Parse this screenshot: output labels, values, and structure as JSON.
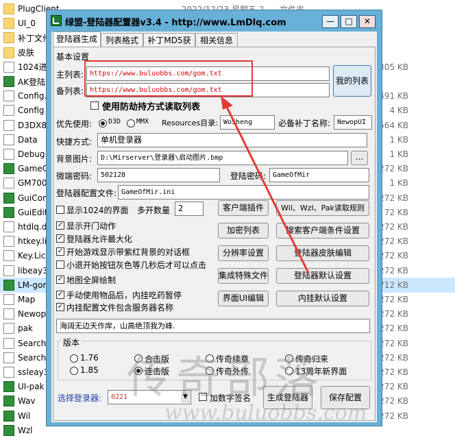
{
  "explorer": {
    "rows": [
      {
        "name": "PlugClient",
        "date": "2022/12/23 星期五 2...",
        "type": "文件夹",
        "size": "",
        "icon": "folder-icon"
      },
      {
        "name": "UI_0",
        "size": "",
        "icon": "folder-icon"
      },
      {
        "name": "补丁文件",
        "size": "",
        "icon": "folder-icon"
      },
      {
        "name": "皮肤",
        "size": "",
        "icon": "folder-icon"
      },
      {
        "name": "1024进",
        "size": "305 KB",
        "icon": "bmp-file-icon"
      },
      {
        "name": "AK登陆",
        "size": "",
        "icon": "ak-app-icon"
      },
      {
        "name": "Config.",
        "size": "491 KB",
        "icon": "config-file-icon"
      },
      {
        "name": "Config",
        "size": "4 KB",
        "icon": "config-file-icon"
      },
      {
        "name": "D3DX8",
        "size": "564 KB",
        "icon": "dll-file-icon"
      },
      {
        "name": "Data",
        "size": "1 KB",
        "icon": "file-icon"
      },
      {
        "name": "Debug",
        "size": "1 KB",
        "icon": "file-icon"
      },
      {
        "name": "GameC",
        "size": "272 KB",
        "icon": "app-icon"
      },
      {
        "name": "GM700",
        "size": "1 KB",
        "icon": "file-icon"
      },
      {
        "name": "GuiCon",
        "size": "272 KB",
        "icon": "app-icon"
      },
      {
        "name": "GuiEdit",
        "size": "72 KB",
        "icon": "app-icon"
      },
      {
        "name": "htdlq.d",
        "size": "272 KB",
        "icon": "dll-file-icon"
      },
      {
        "name": "htkey.li",
        "size": "272 KB",
        "icon": "file-icon"
      },
      {
        "name": "Key.Lic",
        "size": "272 KB",
        "icon": "file-icon"
      },
      {
        "name": "libeay3",
        "size": "272 KB",
        "icon": "dll-file-icon"
      },
      {
        "name": "LM-gor",
        "size": "712 KB",
        "icon": "lm-app-icon",
        "selected": true
      },
      {
        "name": "Map",
        "size": "272 KB",
        "icon": "file-icon"
      },
      {
        "name": "Newop",
        "size": "272 KB",
        "icon": "file-icon"
      },
      {
        "name": "pak",
        "size": "272 KB",
        "icon": "file-icon"
      },
      {
        "name": "SearchI",
        "size": "272 KB",
        "icon": "file-icon"
      },
      {
        "name": "SearchI",
        "size": "272 KB",
        "icon": "file-icon"
      },
      {
        "name": "ssleay3",
        "size": "272 KB",
        "icon": "dll-file-icon"
      },
      {
        "name": "UI-pak",
        "size": "272 KB",
        "icon": "app-icon"
      },
      {
        "name": "Wav",
        "size": "272 KB",
        "icon": "app-icon"
      },
      {
        "name": "Wil",
        "size": "272 KB",
        "icon": "app-icon"
      },
      {
        "name": "Wzl",
        "size": "",
        "icon": "app-icon"
      }
    ]
  },
  "window": {
    "title": "绿盟-登陆器配置器v3.4 - http://www.LmDlq.com",
    "controls": {
      "min": "—",
      "max": "□",
      "close": "✕"
    },
    "tabs": [
      "登陆器生成",
      "列表格式",
      "补丁MD5获取",
      "相关信息"
    ],
    "section_basic": "基本设置",
    "main_list_label": "主列表:",
    "main_list_value": "https://www.buluobbs.com/gom.txt",
    "backup_list_label": "备列表:",
    "backup_list_value": "https://www.buluobbs.com/gom.txt",
    "my_list_button": "我的列表",
    "anti_hijack_label": "使用防劫持方式读取列表",
    "priority_label": "优先使用:",
    "priority_d3d": "D3D",
    "priority_mmx": "MMX",
    "resources_label": "Resources目录:",
    "resources_value": "WoSheng",
    "patch_name_label": "必备补丁名称:",
    "patch_name_value": "NewopUI",
    "shortcut_label": "快捷方式:",
    "shortcut_value": "单机登录器",
    "bg_image_label": "背景图片:",
    "bg_image_value": "D:\\Mirserver\\登录器\\启动图片.bmp",
    "browse_button": "...",
    "wd_password_label": "微端密码:",
    "wd_password_value": "502128",
    "login_password_label": "登陆密码:",
    "login_password_value": "GameOfMir",
    "config_file_label": "登陆器配置文件:",
    "config_file_value": "GameOfMir.ini",
    "checkboxes": [
      {
        "label": "显示1024的界面",
        "checked": false
      },
      {
        "label": "显示开门动作",
        "checked": true
      },
      {
        "label": "登陆器允许最大化",
        "checked": true
      },
      {
        "label": "开始游戏显示带紫红背景的对话框",
        "checked": true
      },
      {
        "label": "小退开始按钮灰色等几秒后才可以点击",
        "checked": false
      },
      {
        "label": "地图全屏绘制",
        "checked": true
      },
      {
        "label": "手动使用物品后，内挂吃药暂停",
        "checked": true
      },
      {
        "label": "内挂配置文件包含服务器名称",
        "checked": true
      }
    ],
    "multi_open_label": "多开数量",
    "multi_open_value": "2",
    "buttons_mid": [
      "客户端插件",
      "加密列表",
      "分辨率设置",
      "集成特殊文件",
      "界面UI编辑"
    ],
    "buttons_right": [
      "Wil、Wzl、Pak读取规则",
      "搜索客户端条件设置",
      "登陆器皮肤编辑",
      "登陆器默认设置",
      "内挂默认设置"
    ],
    "motto_value": "海阔无边天作岸，山高绝顶我为峰.",
    "version_label": "版本",
    "versions": [
      {
        "label": "1.76",
        "selected": false
      },
      {
        "label": "合击版",
        "selected": false
      },
      {
        "label": "传奇续章",
        "selected": false
      },
      {
        "label": "传奇归来",
        "selected": false
      },
      {
        "label": "1.85",
        "selected": false
      },
      {
        "label": "连击版",
        "selected": true
      },
      {
        "label": "传奇外传",
        "selected": false
      },
      {
        "label": "13周年新界面",
        "selected": false
      }
    ],
    "select_login_label": "选择登录器:",
    "select_login_value": "0221",
    "digital_sign_label": "加数字签名",
    "generate_button": "生成登陆器",
    "save_button": "保存配置"
  },
  "watermark": {
    "brand": "传奇部落",
    "url": "www.buluobbs.com"
  },
  "colors": {
    "title_bar": "#67b0d8",
    "annotation": "#e53935",
    "url_text": "#d40000",
    "selected_row": "#cce8ff"
  }
}
